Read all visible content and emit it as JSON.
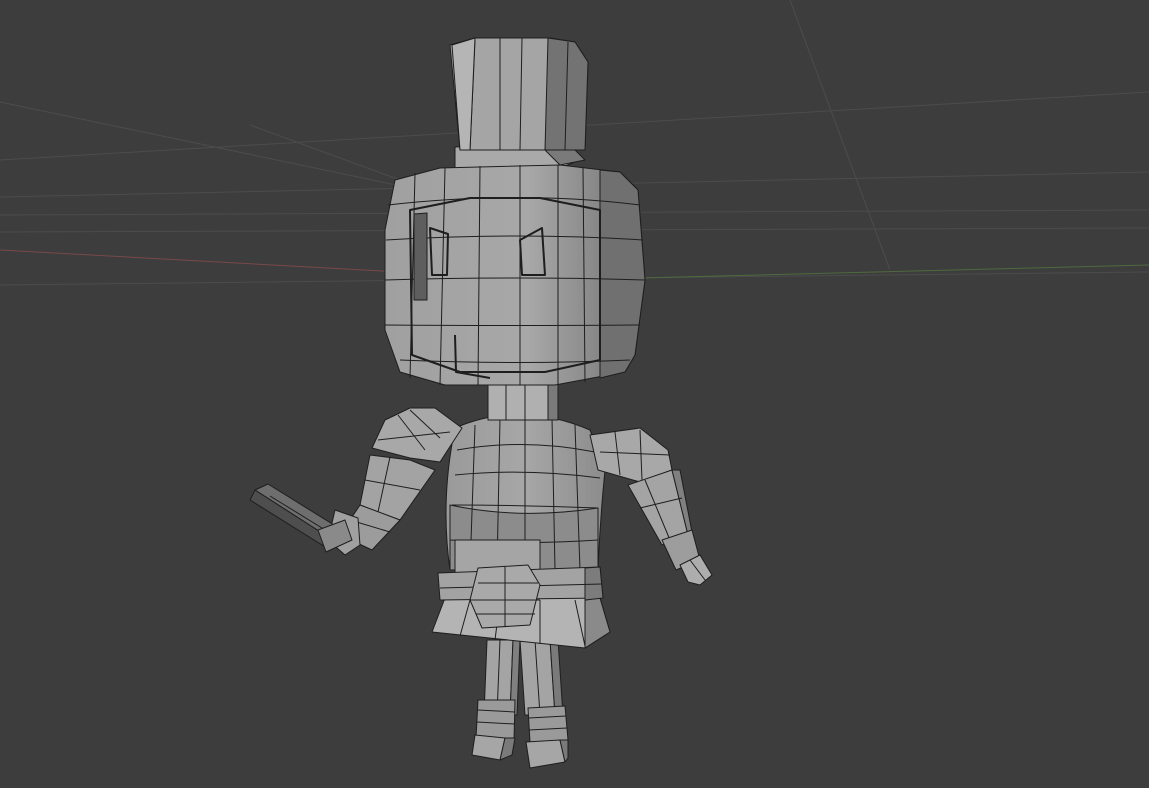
{
  "viewport": {
    "mode": "solid-wireframe",
    "colors": {
      "background": "#3d3d3d",
      "grid_line": "#4c4c4c",
      "x_axis": "#7a4848",
      "y_axis": "#4f6a3e",
      "mesh_fill": "#a3a3a3",
      "mesh_shadow": "#7c7c7c",
      "mesh_highlight": "#b9b9b9",
      "mesh_edge": "#1e1e1e",
      "sword": "#6e6e6e"
    }
  },
  "model": {
    "parts": [
      "hat",
      "head",
      "face",
      "neck",
      "torso",
      "belt",
      "left-arm",
      "right-arm",
      "sword",
      "left-leg",
      "right-leg"
    ]
  }
}
